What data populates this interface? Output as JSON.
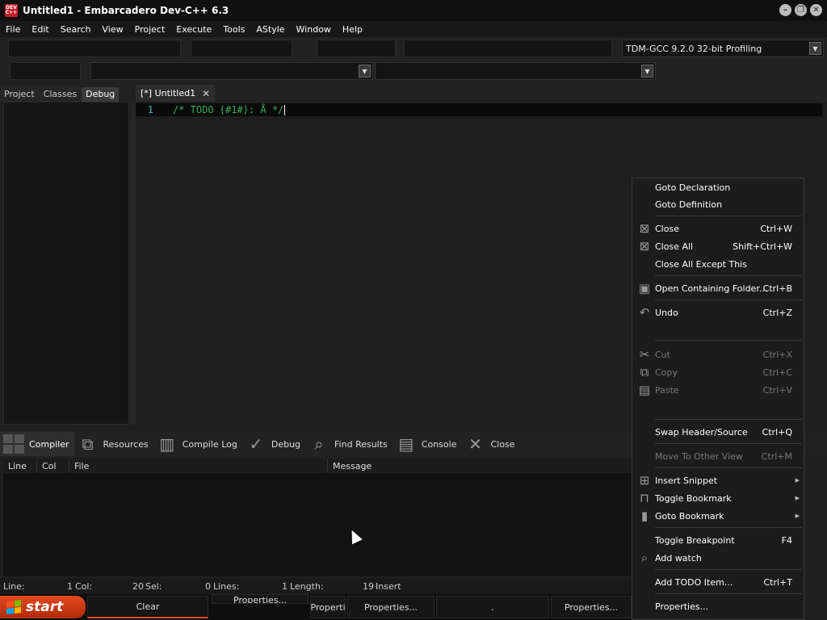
{
  "window": {
    "title": "Untitled1 - Embarcadero Dev-C++ 6.3",
    "icon_text": "DEV C++",
    "minimize_glyph": "–",
    "restore_glyph": "❐",
    "close_glyph": "✕"
  },
  "menu": [
    "File",
    "Edit",
    "Search",
    "View",
    "Project",
    "Execute",
    "Tools",
    "AStyle",
    "Window",
    "Help"
  ],
  "toolbar": {
    "compiler_select": "TDM-GCC 9.2.0 32-bit Profiling",
    "arrow_glyph": "▼"
  },
  "left_tabs": [
    "Project",
    "Classes",
    "Debug"
  ],
  "editor": {
    "tab_label": "[*] Untitled1",
    "tab_close": "✕",
    "line_number": "1",
    "code": "/* TODO (#1#): Å */"
  },
  "bottom_tabs": [
    {
      "label": "Compiler",
      "icon": "grid-icon"
    },
    {
      "label": "Resources",
      "icon": "resources-icon",
      "glyph": "⧉"
    },
    {
      "label": "Compile Log",
      "icon": "bar-chart-icon",
      "glyph": "▥"
    },
    {
      "label": "Debug",
      "icon": "check-icon",
      "glyph": "✓"
    },
    {
      "label": "Find Results",
      "icon": "find-icon",
      "glyph": "⌕"
    },
    {
      "label": "Console",
      "icon": "console-icon",
      "glyph": "▤"
    },
    {
      "label": "Close",
      "icon": "close-icon",
      "glyph": "✕"
    }
  ],
  "messages": {
    "columns": [
      "Line",
      "Col",
      "File",
      "Message"
    ]
  },
  "status": {
    "line_label": "Line:",
    "line_value": "1",
    "col_label": "Col:",
    "col_value": "20",
    "sel_label": "Sel:",
    "sel_value": "0",
    "lines_label": "Lines:",
    "lines_value": "1",
    "length_label": "Length:",
    "length_value": "19",
    "mode": "Insert"
  },
  "taskbar": {
    "start": "start",
    "buttons": [
      "Clear",
      "Properties...",
      "Properti",
      "Properties...",
      ".",
      "Properties..."
    ]
  },
  "context_menu": {
    "items": [
      {
        "label": "Goto Declaration",
        "shortcut": "",
        "icon": "",
        "glyph": "",
        "enabled": true
      },
      {
        "label": "Goto Definition",
        "shortcut": "",
        "icon": "",
        "glyph": "",
        "enabled": true
      },
      {
        "label": "Close",
        "shortcut": "Ctrl+W",
        "icon": "close-file-icon",
        "glyph": "⊠",
        "enabled": true
      },
      {
        "label": "Close All",
        "shortcut": "Shift+Ctrl+W",
        "icon": "close-all-icon",
        "glyph": "⊠",
        "enabled": true
      },
      {
        "label": "Close All Except This",
        "shortcut": "",
        "icon": "",
        "glyph": "",
        "enabled": true
      },
      {
        "label": "Open Containing Folder...",
        "shortcut": "Ctrl+B",
        "icon": "folder-icon",
        "glyph": "▣",
        "enabled": true
      },
      {
        "label": "Undo",
        "shortcut": "Ctrl+Z",
        "icon": "undo-icon",
        "glyph": "↶",
        "enabled": true
      },
      {
        "label": "Cut",
        "shortcut": "Ctrl+X",
        "icon": "scissors-icon",
        "glyph": "✂",
        "enabled": false
      },
      {
        "label": "Copy",
        "shortcut": "Ctrl+C",
        "icon": "copy-icon",
        "glyph": "⧉",
        "enabled": false
      },
      {
        "label": "Paste",
        "shortcut": "Ctrl+V",
        "icon": "paste-icon",
        "glyph": "▤",
        "enabled": false
      },
      {
        "label": "Swap Header/Source",
        "shortcut": "Ctrl+Q",
        "icon": "",
        "glyph": "",
        "enabled": true
      },
      {
        "label": "Move To Other View",
        "shortcut": "Ctrl+M",
        "icon": "",
        "glyph": "",
        "enabled": false
      },
      {
        "label": "Insert Snippet",
        "shortcut": "",
        "icon": "snippet-icon",
        "glyph": "⊞",
        "enabled": true,
        "submenu": true
      },
      {
        "label": "Toggle Bookmark",
        "shortcut": "",
        "icon": "bookmark-icon",
        "glyph": "⊓",
        "enabled": true,
        "submenu": true
      },
      {
        "label": "Goto Bookmark",
        "shortcut": "",
        "icon": "bookmark-filled-icon",
        "glyph": "▮",
        "enabled": true,
        "submenu": true
      },
      {
        "label": "Toggle Breakpoint",
        "shortcut": "F4",
        "icon": "",
        "glyph": "",
        "enabled": true
      },
      {
        "label": "Add watch",
        "shortcut": "",
        "icon": "watch-icon",
        "glyph": "⌕",
        "enabled": true
      },
      {
        "label": "Add TODO Item...",
        "shortcut": "Ctrl+T",
        "icon": "",
        "glyph": "",
        "enabled": true
      },
      {
        "label": "Properties...",
        "shortcut": "",
        "icon": "",
        "glyph": "",
        "enabled": true
      }
    ],
    "submenu_glyph": "▶"
  },
  "colors": {
    "accent": "#e04a1a",
    "line_number": "#3cb4c8",
    "comment": "#3cae58"
  }
}
